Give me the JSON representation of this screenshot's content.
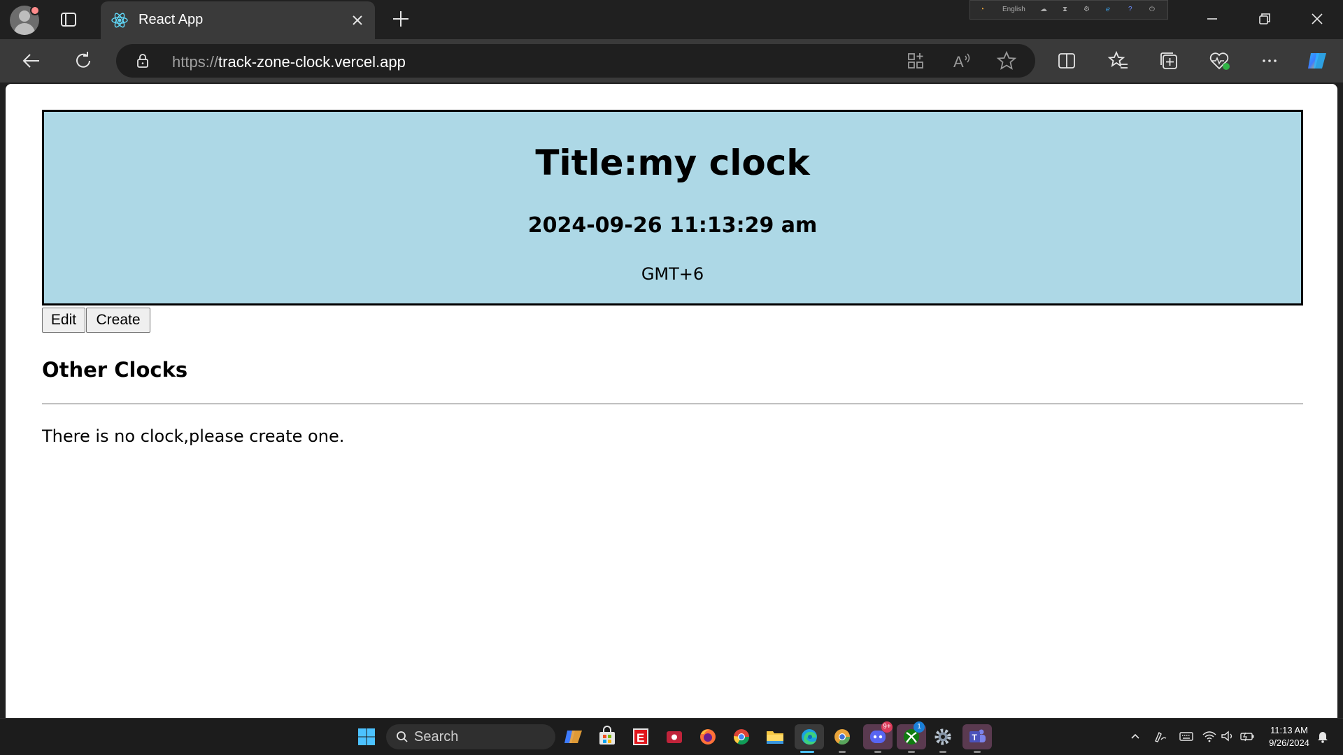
{
  "browser": {
    "tab_title": "React App",
    "url_protocol": "https://",
    "url_host": "track-zone-clock.vercel.app",
    "extension_strip_label": "English"
  },
  "clock": {
    "title": "Title:my clock",
    "datetime": "2024-09-26 11:13:29 am",
    "timezone": "GMT+6"
  },
  "actions": {
    "edit_label": "Edit",
    "create_label": "Create"
  },
  "other_clocks": {
    "heading": "Other Clocks",
    "empty_message": "There is no clock,please create one."
  },
  "taskbar": {
    "search_label": "Search",
    "discord_badge": "9+",
    "xbox_badge": "1",
    "time": "11:13 AM",
    "date": "9/26/2024"
  },
  "colors": {
    "card_bg": "#add8e6",
    "browser_frame": "#202020",
    "toolbar": "#3a3a3a",
    "accent": "#4cc2ff"
  }
}
